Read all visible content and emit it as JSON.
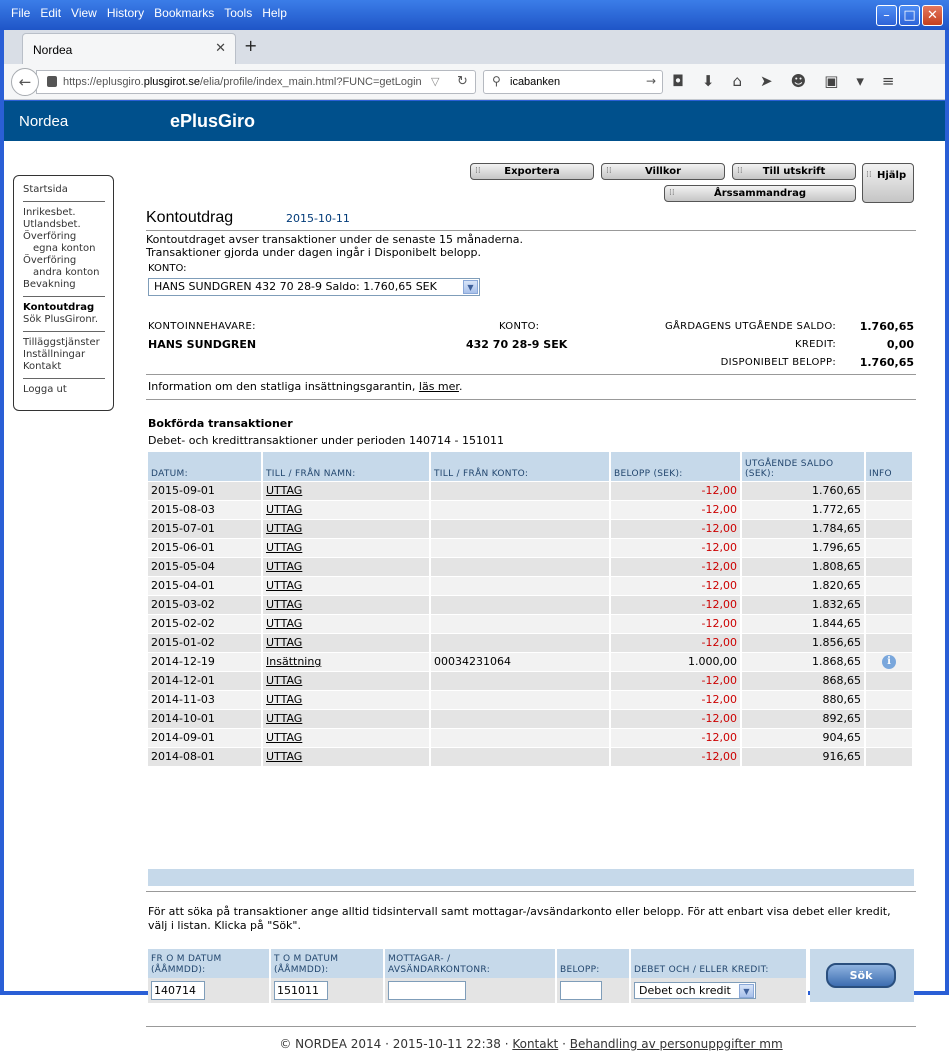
{
  "menu": [
    "File",
    "Edit",
    "View",
    "History",
    "Bookmarks",
    "Tools",
    "Help"
  ],
  "tab": {
    "title": "Nordea"
  },
  "url": {
    "prefix": "https://eplusgiro.",
    "domain": "plusgirot.se",
    "rest": "/elia/profile/index_main.html?FUNC=getLogin"
  },
  "search": {
    "value": "icabanken"
  },
  "brand": {
    "logo": "Nordea",
    "product": "ePlusGiro"
  },
  "nav": {
    "g1": [
      "Startsida"
    ],
    "g2": [
      "Inrikesbet.",
      "Utlandsbet.",
      "Överföring",
      "egna konton",
      "Överföring",
      "andra konton",
      "Bevakning"
    ],
    "g3": [
      "Kontoutdrag",
      "Sök PlusGironr."
    ],
    "g4": [
      "Tilläggstjänster",
      "Inställningar",
      "Kontakt"
    ],
    "g5": [
      "Logga ut"
    ]
  },
  "buttons": {
    "exportera": "Exportera",
    "villkor": "Villkor",
    "utskrift": "Till utskrift",
    "arssammandrag": "Årssammandrag",
    "hjalp": "Hjälp"
  },
  "page": {
    "title": "Kontoutdrag",
    "date": "2015-10-11",
    "intro1": "Kontoutdraget avser transaktioner under de senaste 15 månaderna.",
    "intro2": "Transaktioner gjorda under dagen ingår i Disponibelt belopp.",
    "konto_label": "KONTO:",
    "konto_select": "HANS SUNDGREN 432 70 28-9    Saldo: 1.760,65 SEK"
  },
  "summary": {
    "owner_label": "KONTOINNEHAVARE:",
    "owner": "HANS SUNDGREN",
    "konto_label": "KONTO:",
    "konto": "432 70 28-9 SEK",
    "saldo_label": "GÅRDAGENS UTGÅENDE SALDO:",
    "saldo": "1.760,65",
    "kredit_label": "KREDIT:",
    "kredit": "0,00",
    "disp_label": "DISPONIBELT BELOPP:",
    "disp": "1.760,65"
  },
  "garanti": {
    "text": "Information om den statliga insättningsgarantin, ",
    "link": "läs mer",
    "end": "."
  },
  "trans": {
    "title": "Bokförda transaktioner",
    "period": "Debet- och kredittransaktioner under perioden 140714 - 151011",
    "headers": [
      "DATUM:",
      "TILL / FRÅN NAMN:",
      "TILL / FRÅN KONTO:",
      "BELOPP (SEK):",
      "UTGÅENDE SALDO (SEK):",
      "INFO"
    ],
    "rows": [
      {
        "date": "2015-09-01",
        "name": "UTTAG",
        "konto": "",
        "belopp": "-12,00",
        "saldo": "1.760,65",
        "neg": true,
        "info": false
      },
      {
        "date": "2015-08-03",
        "name": "UTTAG",
        "konto": "",
        "belopp": "-12,00",
        "saldo": "1.772,65",
        "neg": true,
        "info": false
      },
      {
        "date": "2015-07-01",
        "name": "UTTAG",
        "konto": "",
        "belopp": "-12,00",
        "saldo": "1.784,65",
        "neg": true,
        "info": false
      },
      {
        "date": "2015-06-01",
        "name": "UTTAG",
        "konto": "",
        "belopp": "-12,00",
        "saldo": "1.796,65",
        "neg": true,
        "info": false
      },
      {
        "date": "2015-05-04",
        "name": "UTTAG",
        "konto": "",
        "belopp": "-12,00",
        "saldo": "1.808,65",
        "neg": true,
        "info": false
      },
      {
        "date": "2015-04-01",
        "name": "UTTAG",
        "konto": "",
        "belopp": "-12,00",
        "saldo": "1.820,65",
        "neg": true,
        "info": false
      },
      {
        "date": "2015-03-02",
        "name": "UTTAG",
        "konto": "",
        "belopp": "-12,00",
        "saldo": "1.832,65",
        "neg": true,
        "info": false
      },
      {
        "date": "2015-02-02",
        "name": "UTTAG",
        "konto": "",
        "belopp": "-12,00",
        "saldo": "1.844,65",
        "neg": true,
        "info": false
      },
      {
        "date": "2015-01-02",
        "name": "UTTAG",
        "konto": "",
        "belopp": "-12,00",
        "saldo": "1.856,65",
        "neg": true,
        "info": false
      },
      {
        "date": "2014-12-19",
        "name": "Insättning",
        "konto": "00034231064",
        "belopp": "1.000,00",
        "saldo": "1.868,65",
        "neg": false,
        "info": true
      },
      {
        "date": "2014-12-01",
        "name": "UTTAG",
        "konto": "",
        "belopp": "-12,00",
        "saldo": "868,65",
        "neg": true,
        "info": false
      },
      {
        "date": "2014-11-03",
        "name": "UTTAG",
        "konto": "",
        "belopp": "-12,00",
        "saldo": "880,65",
        "neg": true,
        "info": false
      },
      {
        "date": "2014-10-01",
        "name": "UTTAG",
        "konto": "",
        "belopp": "-12,00",
        "saldo": "892,65",
        "neg": true,
        "info": false
      },
      {
        "date": "2014-09-01",
        "name": "UTTAG",
        "konto": "",
        "belopp": "-12,00",
        "saldo": "904,65",
        "neg": true,
        "info": false
      },
      {
        "date": "2014-08-01",
        "name": "UTTAG",
        "konto": "",
        "belopp": "-12,00",
        "saldo": "916,65",
        "neg": true,
        "info": false
      }
    ]
  },
  "searchform": {
    "text": "För att söka på transaktioner ange alltid tidsintervall samt mottagar-/avsändarkonto eller belopp. För att enbart visa debet eller kredit, välj i listan. Klicka på \"Sök\".",
    "from_label": "FR O M DATUM (ÅÅMMDD):",
    "to_label": "T O M DATUM (ÅÅMMDD):",
    "mottagar_label": "MOTTAGAR- / AVSÄNDARKONTONR:",
    "belopp_label": "BELOPP:",
    "debet_label": "DEBET OCH / ELLER KREDIT:",
    "from": "140714",
    "to": "151011",
    "mottagar": "",
    "belopp": "",
    "debet": "Debet och kredit",
    "sok": "Sök"
  },
  "footer": {
    "copy": "© NORDEA 2014 · 2015-10-11 22:38 · ",
    "kontakt": "Kontakt",
    "sep": " · ",
    "behandling": "Behandling av personuppgifter mm"
  }
}
